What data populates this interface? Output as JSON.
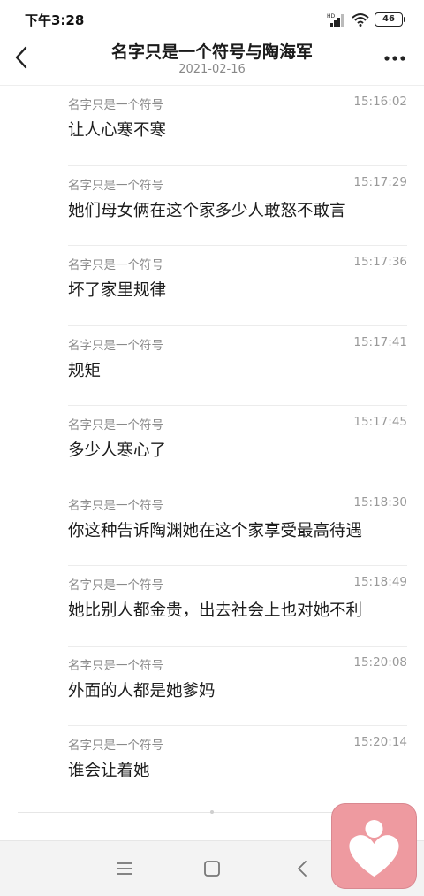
{
  "status_bar": {
    "time": "下午3:28",
    "network_badge": "HD",
    "battery": "46"
  },
  "header": {
    "title": "名字只是一个符号与陶海军",
    "date": "2021-02-16"
  },
  "messages": [
    {
      "sender": "名字只是一个符号",
      "time": "15:16:02",
      "text": "让人心寒不寒"
    },
    {
      "sender": "名字只是一个符号",
      "time": "15:17:29",
      "text": "她们母女俩在这个家多少人敢怒不敢言"
    },
    {
      "sender": "名字只是一个符号",
      "time": "15:17:36",
      "text": "坏了家里规律"
    },
    {
      "sender": "名字只是一个符号",
      "time": "15:17:41",
      "text": "规矩"
    },
    {
      "sender": "名字只是一个符号",
      "time": "15:17:45",
      "text": "多少人寒心了"
    },
    {
      "sender": "名字只是一个符号",
      "time": "15:18:30",
      "text": "你这种告诉陶渊她在这个家享受最高待遇"
    },
    {
      "sender": "名字只是一个符号",
      "time": "15:18:49",
      "text": "她比别人都金贵，出去社会上也对她不利"
    },
    {
      "sender": "名字只是一个符号",
      "time": "15:20:08",
      "text": "外面的人都是她爹妈"
    },
    {
      "sender": "名字只是一个符号",
      "time": "15:20:14",
      "text": "谁会让着她"
    }
  ],
  "icons": {
    "back": "chevron-left-icon",
    "more": "more-dots-icon",
    "nav_menu": "menu-icon",
    "nav_home": "home-square-icon",
    "nav_back": "back-triangle-icon",
    "float": "heart-person-icon"
  },
  "colors": {
    "float_button": "#ee9aa0",
    "nav_bar": "#f3f3f3"
  }
}
